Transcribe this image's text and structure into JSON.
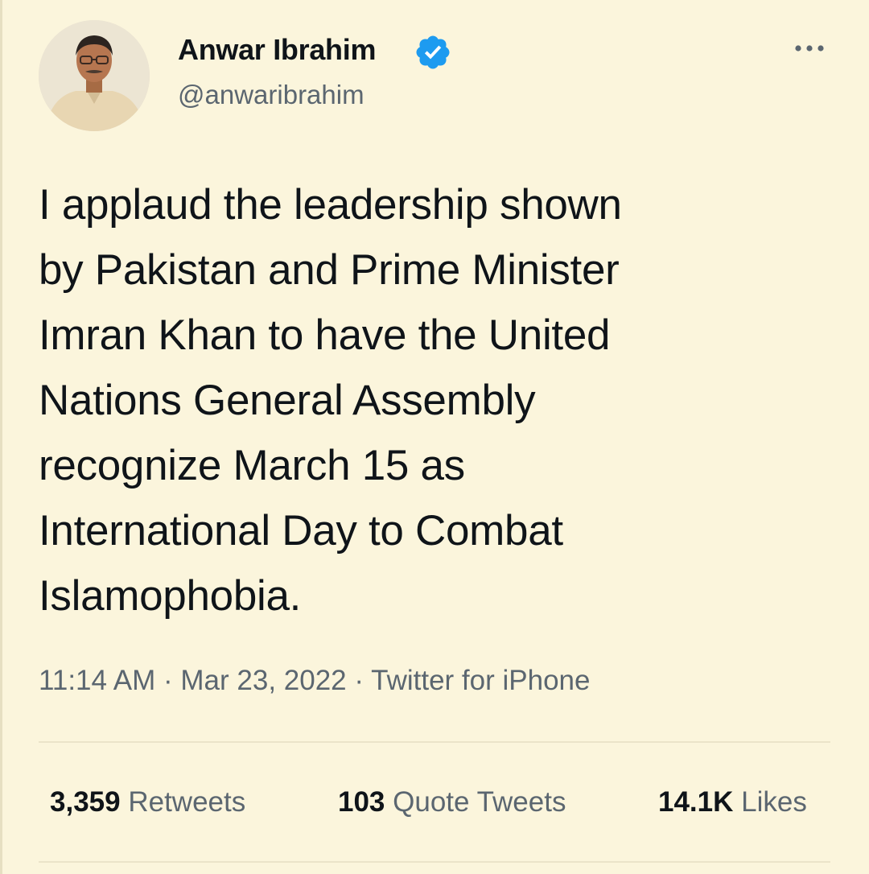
{
  "author": {
    "name": "Anwar Ibrahim",
    "handle": "@anwaribrahim",
    "verified_icon": "verified-badge-icon",
    "verified_color": "#1d9bf0"
  },
  "more_icon": "more-options-icon",
  "tweet": {
    "lines": [
      "I applaud the leadership shown",
      "by Pakistan and Prime Minister",
      "Imran Khan to have the United",
      "Nations General Assembly",
      "recognize March 15 as",
      "International Day to Combat",
      "Islamophobia."
    ]
  },
  "meta": {
    "time": "11:14 AM",
    "date": "Mar 23, 2022",
    "source": "Twitter for iPhone",
    "separator": "·"
  },
  "stats": {
    "retweets": {
      "count": "3,359",
      "label": "Retweets"
    },
    "quote_tweets": {
      "count": "103",
      "label": "Quote Tweets"
    },
    "likes": {
      "count": "14.1K",
      "label": "Likes"
    }
  },
  "colors": {
    "background": "#fbf5dc",
    "text": "#0f1419",
    "secondary": "#5b6670"
  }
}
